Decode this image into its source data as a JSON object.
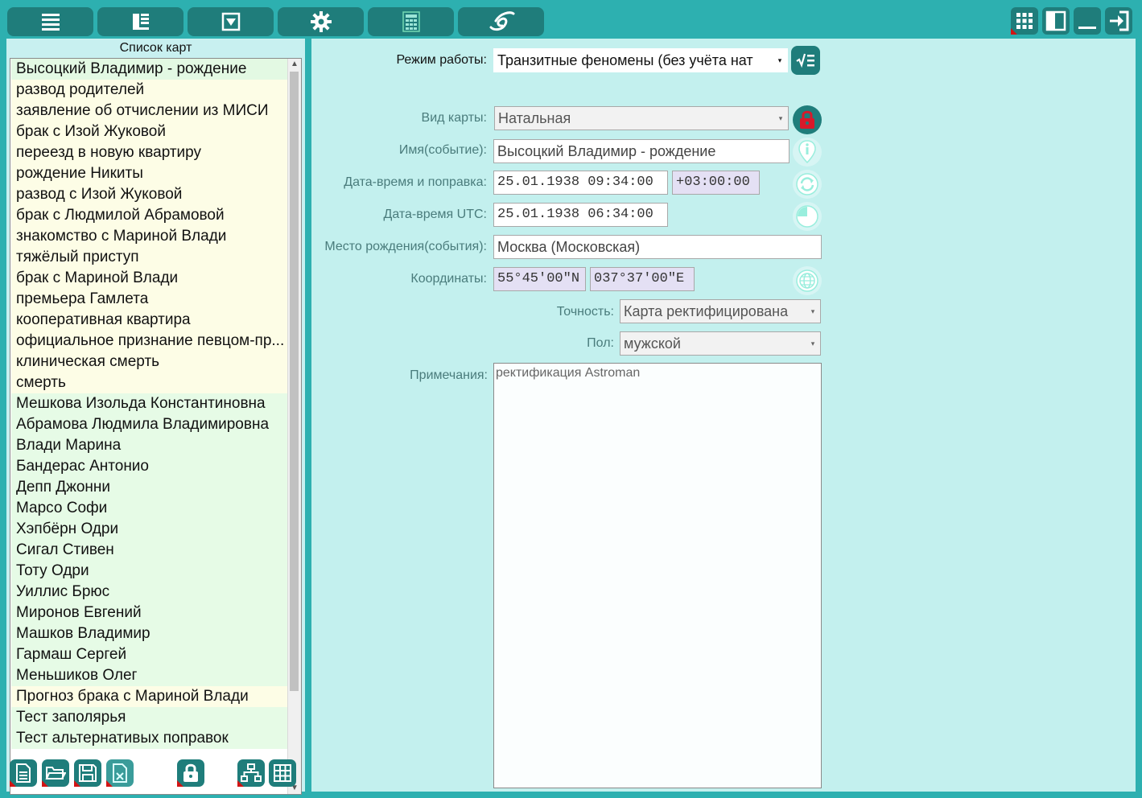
{
  "toolbar": {
    "left_buttons": [
      "menu-icon",
      "layout-icon",
      "dropdown-icon",
      "gear-icon",
      "calculator-icon",
      "logo-icon"
    ],
    "right_buttons": [
      "grid-icon",
      "panel-icon",
      "minimize-icon",
      "exit-icon"
    ]
  },
  "left_panel": {
    "title": "Список карт",
    "items": [
      {
        "label": "Высоцкий Владимир - рождение",
        "color": "sel"
      },
      {
        "label": "развод родителей",
        "color": "yellow"
      },
      {
        "label": "заявление об отчислении из МИСИ",
        "color": "yellow"
      },
      {
        "label": "брак с Изой Жуковой",
        "color": "yellow"
      },
      {
        "label": "переезд в новую квартиру",
        "color": "yellow"
      },
      {
        "label": "рождение Никиты",
        "color": "yellow"
      },
      {
        "label": "развод с Изой Жуковой",
        "color": "yellow"
      },
      {
        "label": "брак с Людмилой Абрамовой",
        "color": "yellow"
      },
      {
        "label": "знакомство с Мариной Влади",
        "color": "yellow"
      },
      {
        "label": "тяжёлый приступ",
        "color": "yellow"
      },
      {
        "label": "брак с Мариной Влади",
        "color": "yellow"
      },
      {
        "label": "премьера Гамлета",
        "color": "yellow"
      },
      {
        "label": "кооперативная квартира",
        "color": "yellow"
      },
      {
        "label": "официальное признание певцом-пр...",
        "color": "yellow"
      },
      {
        "label": "клиническая смерть",
        "color": "yellow"
      },
      {
        "label": "смерть",
        "color": "yellow"
      },
      {
        "label": "Мешкова Изольда Константиновна",
        "color": "green"
      },
      {
        "label": "Абрамова Людмила Владимировна",
        "color": "green"
      },
      {
        "label": "Влади Марина",
        "color": "green"
      },
      {
        "label": "Бандерас Антонио",
        "color": "green"
      },
      {
        "label": "Депп Джонни",
        "color": "green"
      },
      {
        "label": "Марсо Софи",
        "color": "green"
      },
      {
        "label": "Хэпбёрн Одри",
        "color": "green"
      },
      {
        "label": "Сигал Стивен",
        "color": "green"
      },
      {
        "label": "Тоту Одри",
        "color": "green"
      },
      {
        "label": "Уиллис Брюс",
        "color": "green"
      },
      {
        "label": "Миронов Евгений",
        "color": "green"
      },
      {
        "label": "Машков Владимир",
        "color": "green"
      },
      {
        "label": "Гармаш Сергей",
        "color": "green"
      },
      {
        "label": "Меньшиков Олег",
        "color": "green"
      },
      {
        "label": "Прогноз брака с Мариной Влади",
        "color": "yellow"
      },
      {
        "label": "Тест заполярья",
        "color": "green"
      },
      {
        "label": "Тест альтернативых поправок",
        "color": "green"
      }
    ],
    "bottom_buttons": [
      "new-file-icon",
      "open-folder-icon",
      "save-icon",
      "delete-file-icon",
      "lock-icon",
      "hierarchy-icon",
      "table-icon"
    ]
  },
  "form": {
    "mode_label": "Режим работы:",
    "mode_value": "Транзитные феномены (без учёта нат",
    "chart_type_label": "Вид карты:",
    "chart_type_value": "Натальная",
    "name_label": "Имя(событие):",
    "name_value": "Высоцкий Владимир - рождение",
    "datetime_label": "Дата-время и поправка:",
    "datetime_value": "25.01.1938 09:34:00",
    "offset_value": "+03:00:00",
    "utc_label": "Дата-время UTC:",
    "utc_value": "25.01.1938 06:34:00",
    "place_label": "Место рождения(события):",
    "place_value": "Москва (Московская)",
    "coords_label": "Координаты:",
    "lat_value": "55°45'00\"N",
    "lon_value": "037°37'00\"E",
    "accuracy_label": "Точность:",
    "accuracy_value": "Карта ректифицирована",
    "gender_label": "Пол:",
    "gender_value": "мужской",
    "notes_label": "Примечания:",
    "notes_value": "ректификация Astroman"
  },
  "colors": {
    "accent": "#2db0b0",
    "button": "#1f7d7b",
    "lock_red": "#d8192a"
  }
}
